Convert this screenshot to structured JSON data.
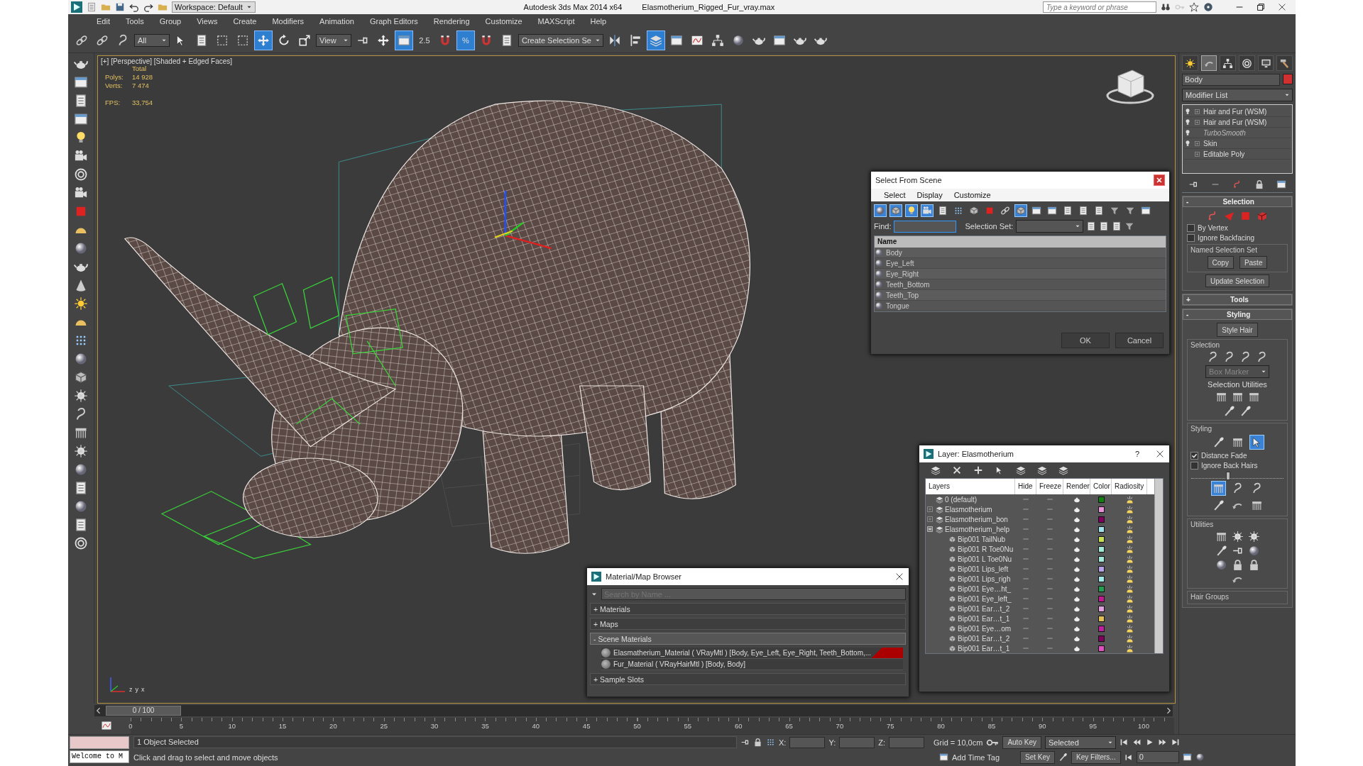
{
  "title_bar": {
    "workspace": "Workspace: Default",
    "app_name": "Autodesk 3ds Max  2014 x64",
    "file_name": "Elasmotherium_Rigged_Fur_vray.max",
    "search": {
      "placeholder": "Type a keyword or phrase"
    }
  },
  "menu": [
    "Edit",
    "Tools",
    "Group",
    "Views",
    "Create",
    "Modifiers",
    "Animation",
    "Graph Editors",
    "Rendering",
    "Customize",
    "MAXScript",
    "Help"
  ],
  "main_toolbar": [
    {
      "kind": "icon",
      "selected": false
    },
    {
      "kind": "icon",
      "selected": false
    },
    {
      "kind": "icon",
      "selected": false
    },
    {
      "kind": "dropdown",
      "value": "All"
    },
    {
      "kind": "icon",
      "selected": false
    },
    {
      "kind": "icon",
      "selected": false
    },
    {
      "kind": "icon",
      "selected": false
    },
    {
      "kind": "icon",
      "selected": false
    },
    {
      "kind": "icon",
      "selected": true
    },
    {
      "kind": "icon",
      "selected": false
    },
    {
      "kind": "icon",
      "selected": false
    },
    {
      "kind": "dropdown",
      "value": "View"
    },
    {
      "kind": "icon",
      "selected": false
    },
    {
      "kind": "icon",
      "selected": false
    },
    {
      "kind": "icon",
      "selected": true
    },
    {
      "kind": "text",
      "label": "2.5",
      "selected": false
    },
    {
      "kind": "icon",
      "selected": false
    },
    {
      "kind": "text",
      "label": "%",
      "selected": true
    },
    {
      "kind": "icon",
      "selected": false
    },
    {
      "kind": "icon",
      "selected": false
    },
    {
      "kind": "dropdown",
      "value": "Create Selection Se"
    },
    {
      "kind": "icon",
      "selected": false
    },
    {
      "kind": "icon",
      "selected": false
    },
    {
      "kind": "icon",
      "selected": true
    },
    {
      "kind": "icon",
      "selected": false
    },
    {
      "kind": "icon",
      "selected": false
    },
    {
      "kind": "icon",
      "selected": false
    },
    {
      "kind": "icon",
      "selected": false
    },
    {
      "kind": "icon",
      "selected": false
    },
    {
      "kind": "icon",
      "selected": false
    },
    {
      "kind": "icon",
      "selected": false
    },
    {
      "kind": "icon",
      "selected": false
    }
  ],
  "viewport": {
    "label": "[+] [Perspective] [Shaded + Edged Faces]",
    "stats": {
      "heading": "Total",
      "rows": [
        {
          "label": "Polys:",
          "value": "14 928"
        },
        {
          "label": "Verts:",
          "value": "7 474"
        },
        {
          "label": "FPS:",
          "value": "33,754"
        }
      ]
    },
    "axis_labels": [
      "z",
      "y",
      "x"
    ]
  },
  "select_from_scene": {
    "title": "Select From Scene",
    "menu": [
      "Select",
      "Display",
      "Customize"
    ],
    "toolbar": [
      {
        "selected": true
      },
      {
        "selected": true
      },
      {
        "selected": true
      },
      {
        "selected": true
      },
      {
        "selected": false
      },
      {
        "selected": false
      },
      {
        "selected": false
      },
      {
        "selected": false
      },
      {
        "selected": false
      },
      {
        "selected": true
      },
      {
        "selected": false
      },
      {
        "selected": false
      },
      {
        "selected": false
      },
      {
        "selected": false
      },
      {
        "selected": false
      },
      {
        "selected": false
      },
      {
        "selected": false
      },
      {
        "selected": false
      }
    ],
    "find_label": "Find:",
    "selection_set_label": "Selection Set:",
    "column": "Name",
    "rows": [
      "Body",
      "Eye_Left",
      "Eye_Right",
      "Teeth_Bottom",
      "Teeth_Top",
      "Tongue"
    ],
    "buttons": [
      "OK",
      "Cancel"
    ]
  },
  "layer_manager": {
    "title": "Layer: Elasmotherium",
    "help": "?",
    "columns": [
      "Layers",
      "Hide",
      "Freeze",
      "Render",
      "Color",
      "Radiosity"
    ],
    "layers": [
      {
        "name": "0 (default)",
        "color": "#108010"
      },
      {
        "name": "Elasmotherium",
        "expanded": false,
        "color": "#e890d8"
      },
      {
        "name": "Elasmotherium_bon",
        "expanded": false,
        "color": "#800060"
      },
      {
        "name": "Elasmotherium_help",
        "expanded": true,
        "color": "#a0e0e8",
        "children": [
          {
            "name": "Bip001 TailNub",
            "color": "#c8e050"
          },
          {
            "name": "Bip001 R Toe0Nu",
            "color": "#a0e8d8"
          },
          {
            "name": "Bip001 L Toe0Nu",
            "color": "#a0e8d8"
          },
          {
            "name": "Bip001 Lips_left",
            "color": "#b8a0e8"
          },
          {
            "name": "Bip001 Lips_righ",
            "color": "#a0e8e8"
          },
          {
            "name": "Bip001 Eye…ht_",
            "color": "#20a050"
          },
          {
            "name": "Bip001 Eye_left_",
            "color": "#c01890"
          },
          {
            "name": "Bip001 Ear…t_2",
            "color": "#e0a0e0"
          },
          {
            "name": "Bip001 Ear…t_1",
            "color": "#e0c050"
          },
          {
            "name": "Bip001 Eye…om",
            "color": "#c020a0"
          },
          {
            "name": "Bip001 Ear…t_2",
            "color": "#800060"
          },
          {
            "name": "Bip001 Ear…t_1",
            "color": "#e050c0"
          }
        ]
      }
    ]
  },
  "material_browser": {
    "title": "Material/Map Browser",
    "search": {
      "placeholder": "Search by Name ..."
    },
    "groups": [
      {
        "label": "+ Materials",
        "expanded": false
      },
      {
        "label": "+ Maps",
        "expanded": false
      },
      {
        "label": "- Scene Materials",
        "expanded": true,
        "items": [
          {
            "label": "Elasmatherium_Material  ( VRayMtl ) [Body, Eye_Left, Eye_Right, Teeth_Bottom,...",
            "flagged": true
          },
          {
            "label": "Fur_Material  ( VRayHairMtl ) [Body, Body]",
            "flagged": false
          }
        ]
      },
      {
        "label": "+ Sample Slots",
        "expanded": false
      }
    ]
  },
  "command_panel": {
    "tabs": [
      {
        "selected": false
      },
      {
        "selected": true
      },
      {
        "selected": false
      },
      {
        "selected": false
      },
      {
        "selected": false
      },
      {
        "selected": false
      }
    ],
    "object": {
      "name": "Body",
      "color": "#d03030"
    },
    "modifier_list": "Modifier List",
    "stack": [
      {
        "label": "Hair and Fur (WSM)",
        "kind": "modifier",
        "enabled": true,
        "expandable": true
      },
      {
        "label": "Hair and Fur (WSM)",
        "kind": "modifier",
        "enabled": true,
        "expandable": true
      },
      {
        "label": "TurboSmooth",
        "kind": "modifier",
        "enabled": false,
        "expandable": false
      },
      {
        "label": "Skin",
        "kind": "modifier",
        "enabled": true,
        "expandable": true
      },
      {
        "label": "Editable Poly",
        "kind": "base",
        "enabled": true,
        "expandable": true
      }
    ],
    "rollouts": [
      {
        "kind": "selection",
        "toggle": "-",
        "title": "Selection",
        "expanded": true,
        "checkboxes": [
          {
            "label": "By Vertex",
            "checked": false
          },
          {
            "label": "Ignore Backfacing",
            "checked": false
          }
        ],
        "named_set_title": "Named Selection Set",
        "named_set_buttons": [
          "Copy",
          "Paste"
        ],
        "update_button": "Update Selection"
      },
      {
        "kind": "plain",
        "toggle": "+",
        "title": "Tools",
        "expanded": false
      },
      {
        "kind": "styling",
        "toggle": "-",
        "title": "Styling",
        "expanded": true,
        "style_button": "Style Hair",
        "groups": [
          {
            "kind": "selection",
            "title": "Selection",
            "dropdown": {
              "value": "Box Marker",
              "disabled": true
            },
            "subtitle": "Selection Utilities"
          },
          {
            "kind": "styling",
            "title": "Styling",
            "tools": [
              {
                "selected": false
              },
              {
                "selected": false
              },
              {
                "selected": true
              }
            ],
            "checkboxes": [
              {
                "label": "Distance Fade",
                "checked": true
              },
              {
                "label": "Ignore Back Hairs",
                "checked": false
              }
            ],
            "slider": {
              "level": 0.4
            },
            "brushes": [
              {
                "selected": true
              },
              {
                "selected": false
              },
              {
                "selected": false
              },
              {
                "selected": false
              },
              {
                "selected": false
              },
              {
                "selected": false
              }
            ]
          },
          {
            "kind": "utilities",
            "title": "Utilities"
          },
          {
            "kind": "plain",
            "title": "Hair Groups"
          }
        ]
      }
    ]
  },
  "time_slider": {
    "position": "0 / 100",
    "level": 0
  },
  "track_bar": {
    "ticks": [
      "0",
      "5",
      "10",
      "15",
      "20",
      "25",
      "30",
      "35",
      "40",
      "45",
      "50",
      "55",
      "60",
      "65",
      "70",
      "75",
      "80",
      "85",
      "90",
      "95",
      "100"
    ]
  },
  "status_bar": {
    "listener_output": "Welcome to M",
    "selection": "1 Object Selected",
    "prompt": "Click and drag to select and move objects",
    "x_label": "X:",
    "y_label": "Y:",
    "z_label": "Z:",
    "grid": "Grid = 10,0cm",
    "auto_key": "Auto Key",
    "key_mode": "Selected",
    "set_key": "Set Key",
    "key_filters": "Key Filters...",
    "add_time_tag": "Add Time Tag",
    "frame": "0"
  }
}
